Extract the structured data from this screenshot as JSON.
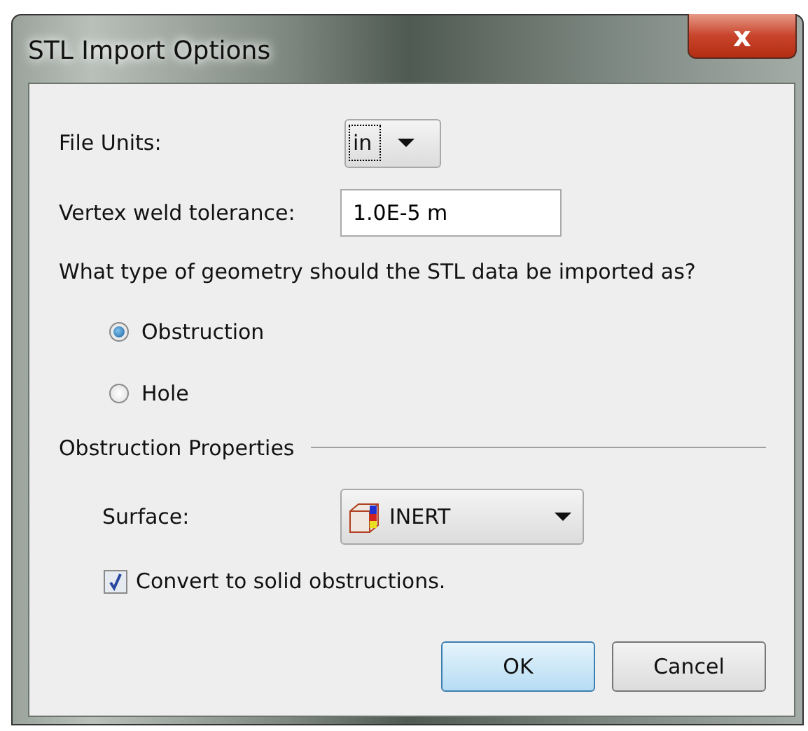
{
  "window": {
    "title": "STL Import Options",
    "close_label": "x"
  },
  "file_units": {
    "label": "File Units:",
    "value": "in",
    "focused": true
  },
  "vertex_weld": {
    "label": "Vertex weld tolerance:",
    "value": "1.0E-5 m"
  },
  "question": "What type of geometry should the STL data be imported as?",
  "geometry_options": [
    {
      "label": "Obstruction",
      "selected": true
    },
    {
      "label": "Hole",
      "selected": false
    }
  ],
  "group_title": "Obstruction Properties",
  "surface": {
    "label": "Surface:",
    "value": "INERT"
  },
  "convert": {
    "label": "Convert to solid obstructions.",
    "checked": true
  },
  "buttons": [
    {
      "label": "OK",
      "default": true
    },
    {
      "label": "Cancel",
      "default": false
    }
  ]
}
